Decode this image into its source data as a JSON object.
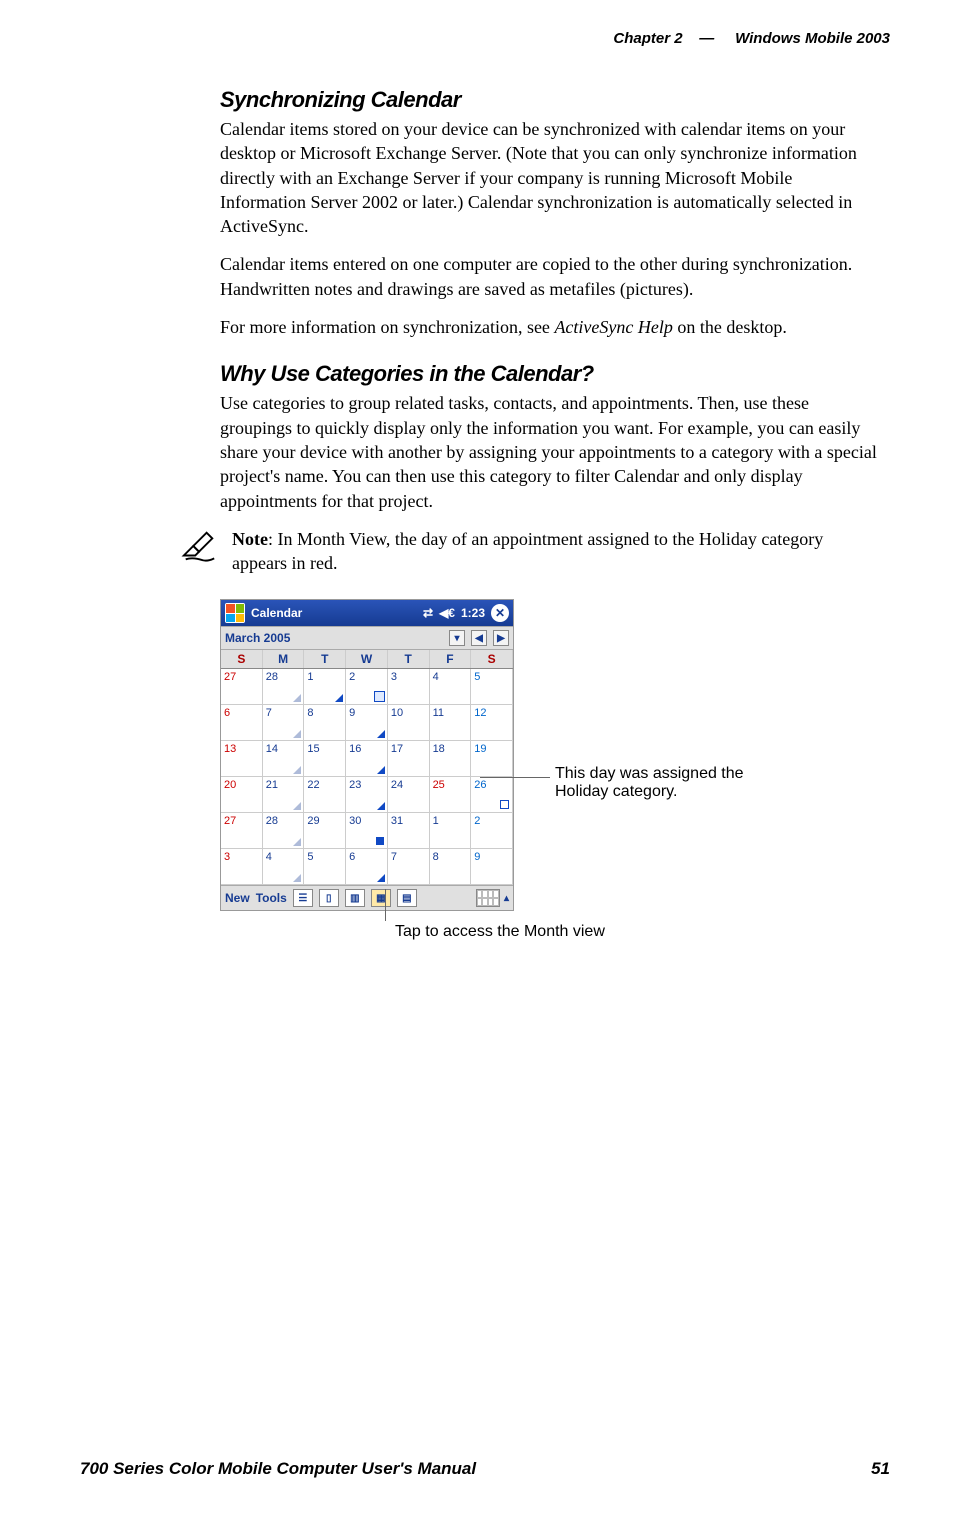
{
  "header": {
    "chapter": "Chapter  2",
    "dash": "—",
    "title": "Windows Mobile 2003"
  },
  "section1": {
    "heading": "Synchronizing Calendar",
    "p1": "Calendar items stored on your device can be synchronized with calendar items on your desktop or Microsoft Exchange Server. (Note that you can only synchronize information directly with an Exchange Server if your company is running Microsoft Mobile Information Server 2002 or later.) Calendar synchronization is automatically selected in ActiveSync.",
    "p2": "Calendar items entered on one computer are copied to the other during synchronization. Handwritten notes and drawings are saved as metafiles (pictures).",
    "p3a": "For more information on synchronization, see ",
    "p3i": "ActiveSync Help",
    "p3b": " on the desktop."
  },
  "section2": {
    "heading": "Why Use Categories in the Calendar?",
    "p1": "Use categories to group related tasks, contacts, and appointments. Then, use these groupings to quickly display only the information you want. For example, you can easily share your device with another by assigning your appointments to a category with a special project's name. You can then use this category to filter Calendar and only display appointments for that project."
  },
  "note": {
    "label": "Note",
    "text": ": In Month View, the day of an appointment assigned to the Holiday category appears in red."
  },
  "screenshot": {
    "app_title": "Calendar",
    "time": "1:23",
    "month_label": "March 2005",
    "day_headers": [
      "S",
      "M",
      "T",
      "W",
      "T",
      "F",
      "S"
    ],
    "weeks": [
      [
        {
          "n": "27",
          "cls": "red",
          "mk": ""
        },
        {
          "n": "28",
          "cls": "",
          "mk": "tri-outline"
        },
        {
          "n": "1",
          "cls": "",
          "mk": "tri-blue"
        },
        {
          "n": "2",
          "cls": "",
          "mk": "note"
        },
        {
          "n": "3",
          "cls": "",
          "mk": ""
        },
        {
          "n": "4",
          "cls": "",
          "mk": ""
        },
        {
          "n": "5",
          "cls": "blue",
          "mk": ""
        }
      ],
      [
        {
          "n": "6",
          "cls": "red",
          "mk": ""
        },
        {
          "n": "7",
          "cls": "",
          "mk": "tri-outline"
        },
        {
          "n": "8",
          "cls": "",
          "mk": ""
        },
        {
          "n": "9",
          "cls": "",
          "mk": "tri-blue"
        },
        {
          "n": "10",
          "cls": "",
          "mk": ""
        },
        {
          "n": "11",
          "cls": "",
          "mk": ""
        },
        {
          "n": "12",
          "cls": "blue",
          "mk": ""
        }
      ],
      [
        {
          "n": "13",
          "cls": "red",
          "mk": ""
        },
        {
          "n": "14",
          "cls": "",
          "mk": "tri-outline"
        },
        {
          "n": "15",
          "cls": "",
          "mk": ""
        },
        {
          "n": "16",
          "cls": "",
          "mk": "tri-blue"
        },
        {
          "n": "17",
          "cls": "",
          "mk": ""
        },
        {
          "n": "18",
          "cls": "",
          "mk": ""
        },
        {
          "n": "19",
          "cls": "blue",
          "mk": ""
        }
      ],
      [
        {
          "n": "20",
          "cls": "red",
          "mk": ""
        },
        {
          "n": "21",
          "cls": "",
          "mk": "tri-outline"
        },
        {
          "n": "22",
          "cls": "",
          "mk": ""
        },
        {
          "n": "23",
          "cls": "",
          "mk": "tri-blue"
        },
        {
          "n": "24",
          "cls": "",
          "mk": ""
        },
        {
          "n": "25",
          "cls": "red",
          "mk": ""
        },
        {
          "n": "26",
          "cls": "blue",
          "mk": "sq-outline"
        }
      ],
      [
        {
          "n": "27",
          "cls": "red",
          "mk": ""
        },
        {
          "n": "28",
          "cls": "",
          "mk": "tri-outline"
        },
        {
          "n": "29",
          "cls": "",
          "mk": ""
        },
        {
          "n": "30",
          "cls": "",
          "mk": "sq-blue"
        },
        {
          "n": "31",
          "cls": "",
          "mk": ""
        },
        {
          "n": "1",
          "cls": "",
          "mk": ""
        },
        {
          "n": "2",
          "cls": "blue",
          "mk": ""
        }
      ],
      [
        {
          "n": "3",
          "cls": "red",
          "mk": ""
        },
        {
          "n": "4",
          "cls": "",
          "mk": "tri-outline"
        },
        {
          "n": "5",
          "cls": "",
          "mk": ""
        },
        {
          "n": "6",
          "cls": "",
          "mk": "tri-blue"
        },
        {
          "n": "7",
          "cls": "",
          "mk": ""
        },
        {
          "n": "8",
          "cls": "",
          "mk": ""
        },
        {
          "n": "9",
          "cls": "blue",
          "mk": ""
        }
      ]
    ],
    "menu_new": "New",
    "menu_tools": "Tools"
  },
  "callouts": {
    "holiday": "This day was assigned the Holiday category.",
    "monthview": "Tap to access the Month view"
  },
  "footer": {
    "left": "700 Series Color Mobile Computer User's Manual",
    "right": "51"
  }
}
